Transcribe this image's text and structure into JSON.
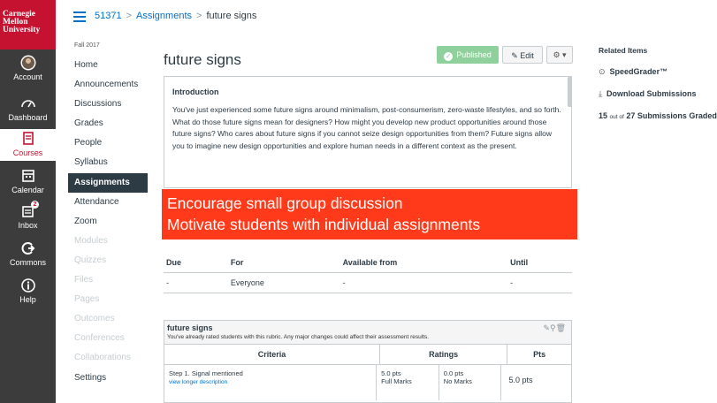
{
  "global_nav": {
    "logo_lines": [
      "Carnegie",
      "Mellon",
      "University"
    ],
    "items": [
      {
        "label": "Account",
        "icon": "avatar-icon"
      },
      {
        "label": "Dashboard",
        "icon": "dashboard-icon"
      },
      {
        "label": "Courses",
        "icon": "courses-icon"
      },
      {
        "label": "Calendar",
        "icon": "calendar-icon"
      },
      {
        "label": "Inbox",
        "icon": "inbox-icon",
        "badge": "2"
      },
      {
        "label": "Commons",
        "icon": "commons-icon"
      },
      {
        "label": "Help",
        "icon": "help-icon"
      }
    ],
    "brand_color": "#c41230"
  },
  "breadcrumb": {
    "course": "51371",
    "section": "Assignments",
    "current": "future signs",
    "separator": ">"
  },
  "course_nav": {
    "term": "Fall 2017",
    "items": [
      {
        "label": "Home",
        "state": "enabled"
      },
      {
        "label": "Announcements",
        "state": "enabled"
      },
      {
        "label": "Discussions",
        "state": "enabled"
      },
      {
        "label": "Grades",
        "state": "enabled"
      },
      {
        "label": "People",
        "state": "enabled"
      },
      {
        "label": "Syllabus",
        "state": "enabled"
      },
      {
        "label": "Assignments",
        "state": "selected"
      },
      {
        "label": "Attendance",
        "state": "enabled"
      },
      {
        "label": "Zoom",
        "state": "enabled"
      },
      {
        "label": "Modules",
        "state": "disabled"
      },
      {
        "label": "Quizzes",
        "state": "disabled"
      },
      {
        "label": "Files",
        "state": "disabled"
      },
      {
        "label": "Pages",
        "state": "disabled"
      },
      {
        "label": "Outcomes",
        "state": "disabled"
      },
      {
        "label": "Conferences",
        "state": "disabled"
      },
      {
        "label": "Collaborations",
        "state": "disabled"
      },
      {
        "label": "Settings",
        "state": "enabled"
      }
    ]
  },
  "assignment": {
    "title": "future signs",
    "published_label": "Published",
    "edit_label": "Edit",
    "description_heading": "Introduction",
    "description_text": "You've just experienced some future signs around minimalism, post-consumerism, zero-waste lifestyles, and so forth. What do those future signs mean for designers? How might you develop new product opportunities around those future signs? Who cares about future signs if you cannot seize design opportunities from them? Future signs allow you to imagine new design opportunities and explore human needs in a different context as the present."
  },
  "overlay": {
    "line1": "Encourage small group discussion",
    "line2": "Motivate students with individual assignments",
    "color": "#ff3a1a"
  },
  "dates_table": {
    "headers": [
      "Due",
      "For",
      "Available from",
      "Until"
    ],
    "row": [
      "-",
      "Everyone",
      "-",
      "-"
    ]
  },
  "rubric": {
    "title": "future signs",
    "notice": "You've already rated students with this rubric. Any major changes could affect their assessment results.",
    "col_criteria": "Criteria",
    "col_ratings": "Ratings",
    "col_pts": "Pts",
    "row1": {
      "criterion": "Step 1. Signal mentioned",
      "link": "view longer description",
      "rating1_pts": "5.0 pts",
      "rating1_label": "Full Marks",
      "rating2_pts": "0.0 pts",
      "rating2_label": "No Marks",
      "pts": "5.0 pts"
    }
  },
  "related": {
    "heading": "Related Items",
    "speedgrader": "SpeedGrader™",
    "download": "Download Submissions",
    "graded_count": "15",
    "graded_mid": "out of",
    "graded_rest": "27 Submissions Graded"
  }
}
